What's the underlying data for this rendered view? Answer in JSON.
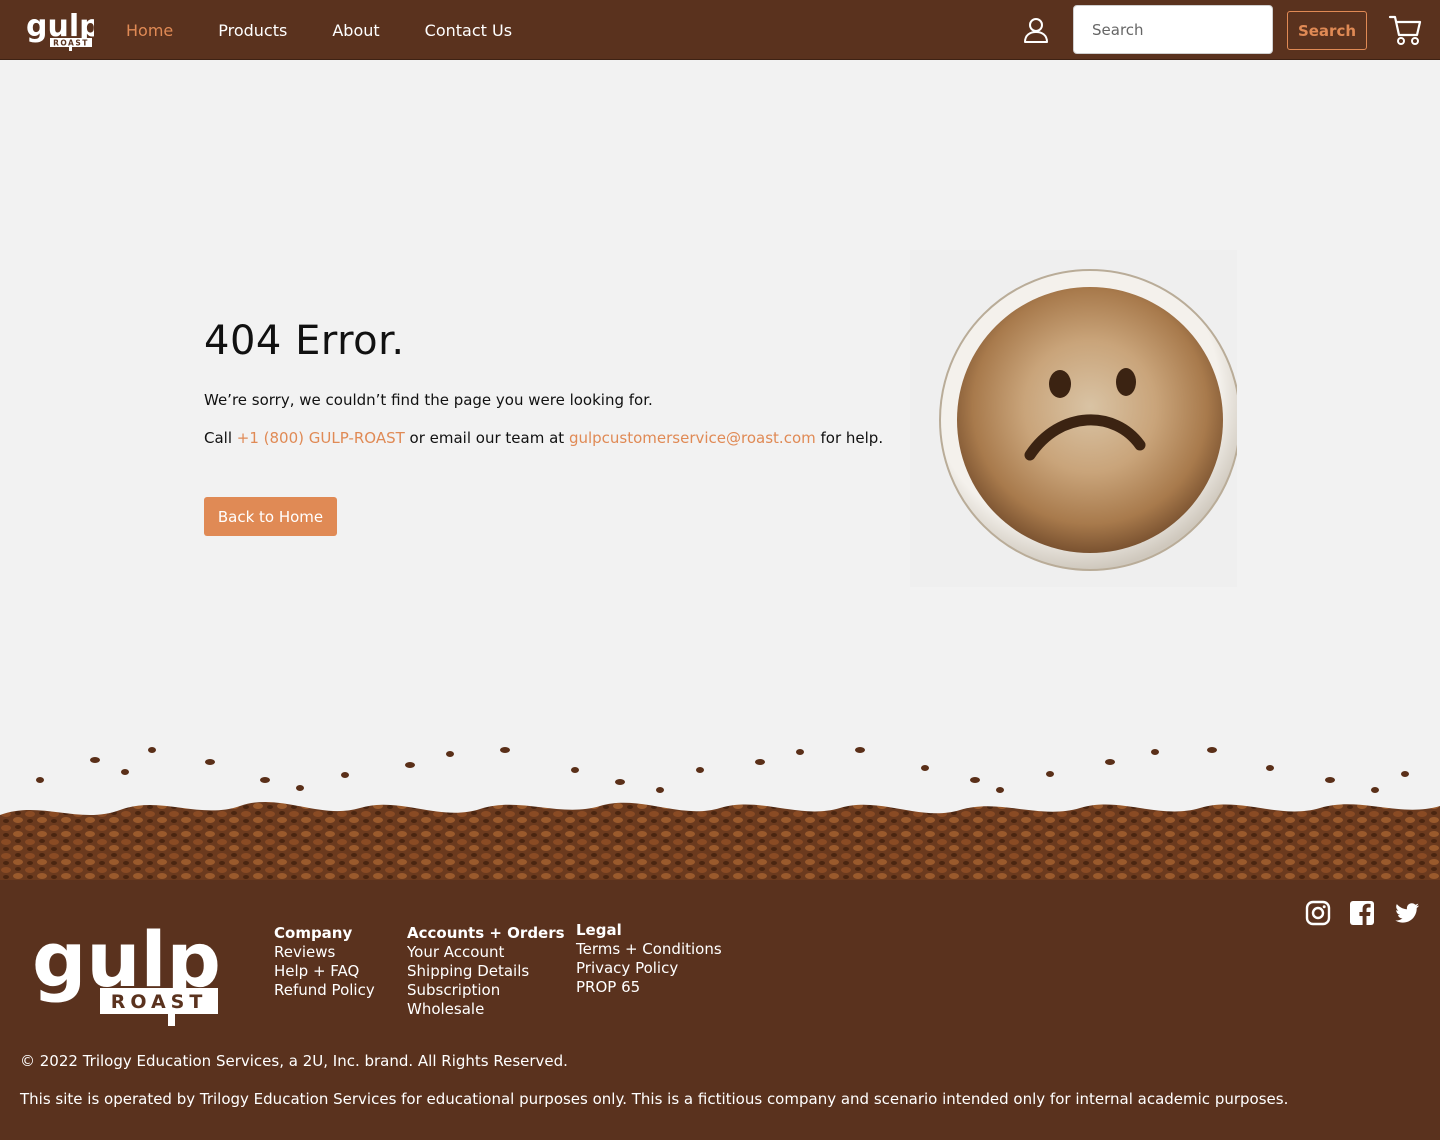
{
  "header": {
    "logo_word": "gulp",
    "logo_sub": "ROAST",
    "nav": [
      "Home",
      "Products",
      "About",
      "Contact Us"
    ],
    "search_placeholder": "Search",
    "search_button": "Search",
    "icons": [
      "user-icon",
      "cart-icon"
    ]
  },
  "main": {
    "title": "404 Error.",
    "message": "We’re sorry, we couldn’t find the page you were looking for.",
    "help": {
      "prefix": "Call ",
      "phone": "+1 (800) GULP-ROAST",
      "middle": " or email our team at ",
      "email": "gulpcustomerservice@roast.com",
      "suffix": " for help."
    },
    "back_button": "Back to Home"
  },
  "footer": {
    "logo_word": "gulp",
    "logo_sub": "ROAST",
    "columns": [
      {
        "heading": "Company",
        "links": [
          "Reviews",
          "Help + FAQ",
          "Refund Policy"
        ]
      },
      {
        "heading": "Accounts + Orders",
        "links": [
          "Your Account",
          "Shipping Details",
          "Subscription",
          "Wholesale"
        ]
      },
      {
        "heading": "Legal",
        "links": [
          "Terms + Conditions",
          "Privacy Policy",
          "PROP 65"
        ]
      }
    ],
    "social_icons": [
      "instagram-icon",
      "facebook-icon",
      "twitter-icon"
    ],
    "copyright": "© 2022 Trilogy Education Services, a 2U, Inc. brand. All Rights Reserved.",
    "disclaimer": "This site is operated by Trilogy Education Services for educational purposes only. This is a fictitious company and scenario intended only for internal academic purposes."
  },
  "colors": {
    "brand_brown": "#5a321e",
    "accent_orange": "#e08a55",
    "page_bg": "#f2f2f2"
  }
}
